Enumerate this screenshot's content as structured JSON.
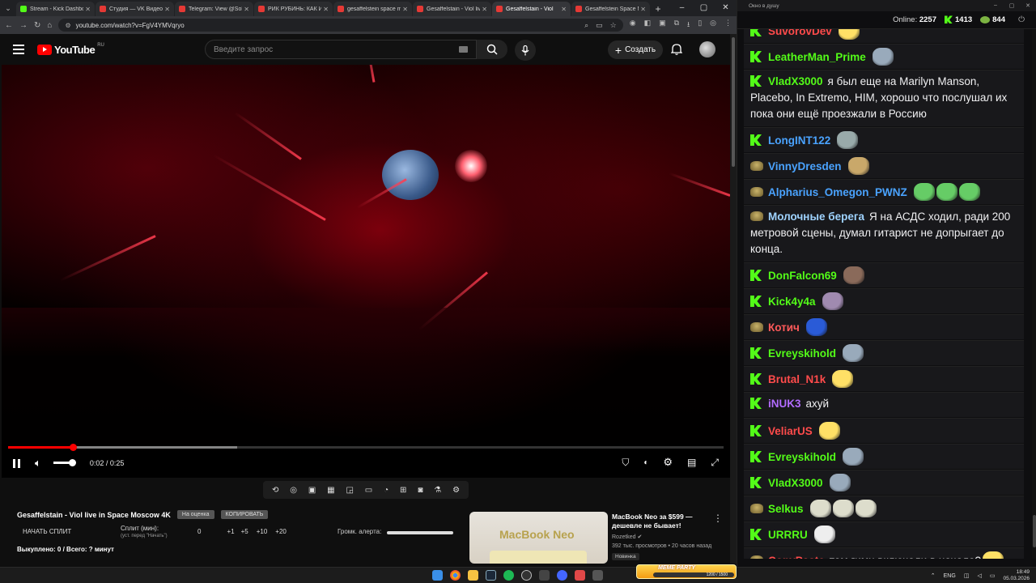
{
  "browser": {
    "tabs": [
      {
        "label": "Stream - Kick Dashboard",
        "color": "#53fc18",
        "active": false
      },
      {
        "label": "Студия — VK Видео Live",
        "color": "#e53935",
        "active": false
      },
      {
        "label": "Telegram: View @Soldie",
        "color": "#e53935",
        "active": false
      },
      {
        "label": "РИК РУБИНЬ: КАК ИЗМЕ",
        "color": "#e53935",
        "active": false
      },
      {
        "label": "gesaffelstein space moscow",
        "color": "#e53935",
        "active": false
      },
      {
        "label": "Gesaffelstain - Viol live",
        "color": "#e53935",
        "active": false
      },
      {
        "label": "Gesaffelstain - Viol",
        "color": "#e53935",
        "active": true
      },
      {
        "label": "Gesaffelstein Space Moscow",
        "color": "#e53935",
        "active": false
      }
    ],
    "new_tab": "+",
    "url": "youtube.com/watch?v=FgV4YMVqryo",
    "ext_badges": [
      "16",
      "2"
    ]
  },
  "youtube": {
    "logo_text": "YouTube",
    "logo_region": "RU",
    "search_placeholder": "Введите запрос",
    "create_label": "Создать"
  },
  "player": {
    "time": "0:02 / 0:25",
    "progress_fraction": 0.09,
    "buffered_fraction": 0.32,
    "volume_fraction": 1.0
  },
  "video_info": {
    "title": "Gesaffelstain - Viol live in Space Moscow 4K",
    "badge1": "На оценка",
    "badge2": "КОПИРОВАТЬ",
    "split_button": "НАЧАТЬ СПЛИТ",
    "split_label": "Сплит (мин):",
    "split_sub": "(уст. перед \"Начать\")",
    "split_values": [
      "0",
      "+1",
      "+5",
      "+10",
      "+20"
    ],
    "alert_label": "Громк. алерта:",
    "bought": "Выкуплено: 0 / Всего: ? минут"
  },
  "recommendation": {
    "thumb_text": "MacBook Neo",
    "title": "MacBook Neo за $599 — дешевле не бывает!",
    "channel": "Rozetked",
    "meta": "392 тыс. просмотров • 20 часов назад",
    "tag": "Новинка"
  },
  "chat": {
    "window_title": "Окно в душу",
    "online_label": "Online:",
    "online_count": "2257",
    "kick_count": "1413",
    "other_count": "844",
    "messages": [
      {
        "badge": "kick",
        "name": "SuvorovDev",
        "color": "#ff4b4b",
        "text": "",
        "emotes": [
          "#ffe066"
        ]
      },
      {
        "badge": "kick",
        "name": "LeatherMan_Prime",
        "color": "#53fc18",
        "text": "",
        "emotes": [
          "#9ab"
        ]
      },
      {
        "badge": "kick",
        "name": "VladX3000",
        "color": "#53fc18",
        "text": "я был еще на Marilyn Manson, Placebo, In Extremo, HIM, хорошо что послушал их пока они ещё проезжали в Россию",
        "emotes": []
      },
      {
        "badge": "kick",
        "name": "LongINT122",
        "color": "#4aa3ff",
        "text": "",
        "emotes": [
          "#9aa"
        ]
      },
      {
        "badge": "b7",
        "name": "VinnyDresden",
        "color": "#4aa3ff",
        "text": "",
        "emotes": [
          "#c9a86a"
        ]
      },
      {
        "badge": "b7",
        "name": "Alpharius_Omegon_PWNZ",
        "color": "#4aa3ff",
        "text": "",
        "emotes": [
          "#6c6",
          "#6c6",
          "#6c6"
        ]
      },
      {
        "badge": "b7",
        "name": "Молочные берега",
        "color": "#9fd3ff",
        "text": "Я на АСДС ходил, ради 200 метровой сцены, думал гитарист не допрыгает до конца.",
        "emotes": []
      },
      {
        "badge": "kick",
        "name": "DonFalcon69",
        "color": "#53fc18",
        "text": "",
        "emotes": [
          "#8a6a5a"
        ]
      },
      {
        "badge": "kick",
        "name": "Kick4y4a",
        "color": "#53fc18",
        "text": "",
        "emotes": [
          "#a08ab0"
        ]
      },
      {
        "badge": "b7",
        "name": "Котич",
        "color": "#ff5a5a",
        "text": "",
        "emotes": [
          "#2a5bd7"
        ]
      },
      {
        "badge": "kick",
        "name": "Evreyskihold",
        "color": "#53fc18",
        "text": "",
        "emotes": [
          "#9ab"
        ]
      },
      {
        "badge": "kick",
        "name": "Brutal_N1k",
        "color": "#ff4b4b",
        "text": "",
        "emotes": [
          "#ffe066"
        ]
      },
      {
        "badge": "kick",
        "name": "iNUK3",
        "color": "#b26bff",
        "text": "ахуй",
        "emotes": []
      },
      {
        "badge": "kick",
        "name": "VeliarUS",
        "color": "#ff4b4b",
        "text": "",
        "emotes": [
          "#ffe066"
        ]
      },
      {
        "badge": "kick",
        "name": "Evreyskihold",
        "color": "#53fc18",
        "text": "",
        "emotes": [
          "#9ab"
        ]
      },
      {
        "badge": "kick",
        "name": "VladX3000",
        "color": "#53fc18",
        "text": "",
        "emotes": [
          "#9ab"
        ]
      },
      {
        "badge": "b7",
        "name": "Selkus",
        "color": "#53fc18",
        "text": "",
        "emotes": [
          "#ddc",
          "#ddc",
          "#ddc"
        ]
      },
      {
        "badge": "kick",
        "name": "URRRU",
        "color": "#53fc18",
        "text": "",
        "emotes": [
          "#eee"
        ]
      },
      {
        "badge": "b7",
        "name": "CopyPaste",
        "color": "#ff4b4b",
        "text": "там гимн включали в начала?",
        "emotes": [
          "#ffe066"
        ]
      }
    ]
  },
  "taskbar": {
    "meme_title": "MEME PARTY",
    "meme_value": "1200 / 1500",
    "lang": "ENG",
    "time": "18:49",
    "date": "05.03.2026"
  }
}
